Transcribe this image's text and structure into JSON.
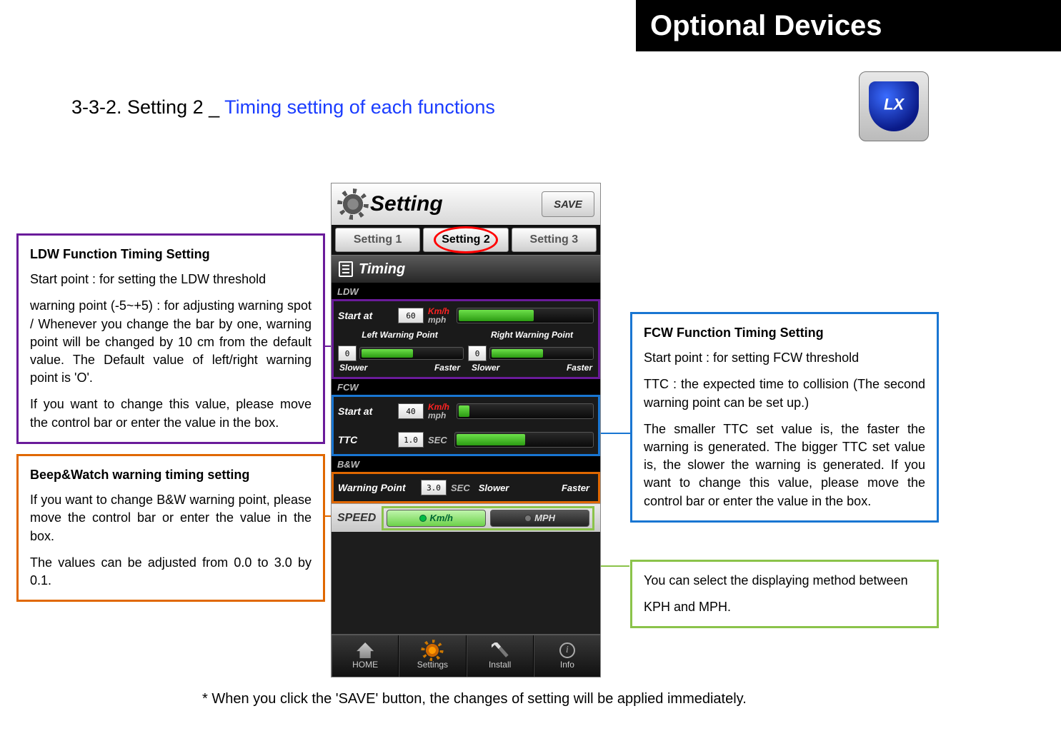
{
  "header": {
    "title": "Optional Devices"
  },
  "section_title": {
    "prefix": "3-3-2. Setting 2 _ ",
    "blue": "Timing setting of each functions"
  },
  "callouts": {
    "ldw": {
      "title": "LDW Function Timing Setting",
      "p1": "Start point : for setting the LDW threshold",
      "p2": "warning point (-5~+5) : for adjusting warning spot / Whenever you change the bar by one, warning point will be changed by 10 cm from the default value. The Default value of left/right warning point is 'O'.",
      "p3": "If you want to change this value, please move the control bar or enter the value in the box."
    },
    "bw": {
      "title": "Beep&Watch warning timing setting",
      "p1": "If you want to change B&W warning point, please move the control bar or enter the value in the box.",
      "p2": "The values can be adjusted from 0.0 to 3.0 by 0.1."
    },
    "fcw": {
      "title": "FCW Function Timing Setting",
      "p1": "Start point : for setting FCW threshold",
      "p2": "TTC : the expected time to collision (The second warning point can be set up.)",
      "p3": "The smaller TTC set value is, the faster the warning is generated. The bigger TTC set value is, the slower the warning is generated. If you want to change this value, please move the control bar or enter the value in the box."
    },
    "speed": {
      "p1": "You can select the displaying method between",
      "p2": "KPH and MPH."
    }
  },
  "phone": {
    "title": "Setting",
    "save": "SAVE",
    "tabs": [
      "Setting 1",
      "Setting 2",
      "Setting 3"
    ],
    "section_timing": "Timing",
    "ldw": {
      "header": "LDW",
      "start_label": "Start at",
      "start_value": "60",
      "kmh": "Km/h",
      "mph": "mph",
      "left_label": "Left Warning Point",
      "right_label": "Right Warning Point",
      "left_value": "0",
      "right_value": "0",
      "slower": "Slower",
      "faster": "Faster"
    },
    "fcw": {
      "header": "FCW",
      "start_label": "Start at",
      "start_value": "40",
      "kmh": "Km/h",
      "mph": "mph",
      "ttc_label": "TTC",
      "ttc_value": "1.0",
      "sec": "SEC"
    },
    "bw": {
      "header": "B&W",
      "label": "Warning Point",
      "value": "3.0",
      "sec": "SEC",
      "slower": "Slower",
      "faster": "Faster"
    },
    "speed": {
      "label": "SPEED",
      "kmh": "Km/h",
      "mph": "MPH"
    },
    "nav": {
      "home": "HOME",
      "settings": "Settings",
      "install": "Install",
      "info": "Info"
    }
  },
  "footnote": "* When you click the 'SAVE' button, the changes of setting will be applied immediately."
}
